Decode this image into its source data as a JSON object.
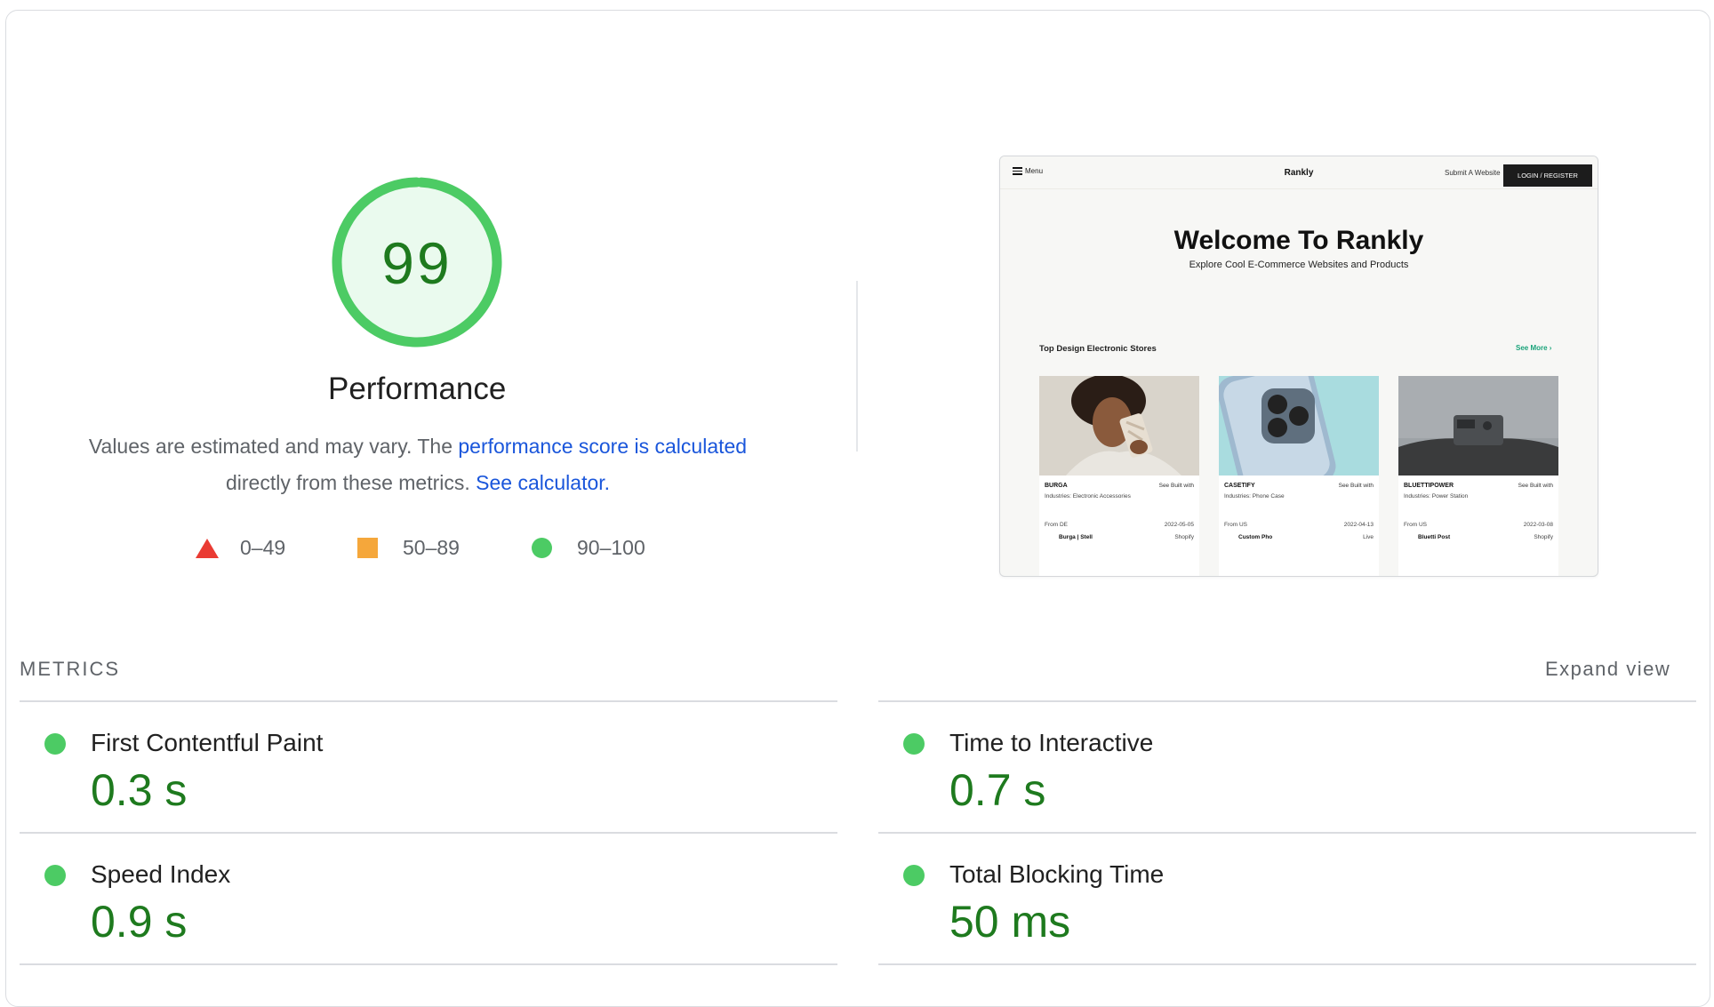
{
  "performance": {
    "score": "99",
    "category_title": "Performance",
    "description_prefix": "Values are estimated and may vary. The",
    "description_link": "performance score is calculated",
    "description_mid": "directly from these metrics.",
    "calculator_link": "See calculator.",
    "gauge_fill_fraction": 0.99,
    "colors": {
      "pass": "#0cce6b",
      "average": "#ffa400",
      "fail": "#ff4e42",
      "score_text": "#1e7a1e",
      "link": "#1a56db"
    }
  },
  "legend": [
    {
      "icon": "triangle-fail-icon",
      "label": "0–49"
    },
    {
      "icon": "square-average-icon",
      "label": "50–89"
    },
    {
      "icon": "circle-pass-icon",
      "label": "90–100"
    }
  ],
  "screenshot": {
    "nav_menu": "Menu",
    "nav_logo": "Rankly",
    "nav_submit": "Submit A Website",
    "nav_login": "LOGIN / REGISTER",
    "headline": "Welcome To Rankly",
    "subheadline": "Explore Cool E-Commerce Websites and Products",
    "section_title": "Top Design Electronic Stores",
    "see_more": "See More",
    "cards": [
      {
        "name": "BURGA",
        "built_with": "See Built with",
        "industry": "Industries:  Electronic Accessories",
        "from": "From DE",
        "date": "2022-05-05",
        "owner": "Burga | Stell",
        "platform": "Shopify"
      },
      {
        "name": "CASETIFY",
        "built_with": "See Built with",
        "industry": "Industries:  Phone Case",
        "from": "From US",
        "date": "2022-04-13",
        "owner": "Custom Pho",
        "platform": "Live"
      },
      {
        "name": "BLUETTIPOWER",
        "built_with": "See Built with",
        "industry": "Industries:  Power Station",
        "from": "From US",
        "date": "2022-03-08",
        "owner": "Bluetti Post",
        "platform": "Shopify"
      }
    ]
  },
  "metrics": {
    "section_label": "METRICS",
    "expand_label": "Expand view",
    "items": [
      {
        "title": "First Contentful Paint",
        "value": "0.3 s",
        "status": "pass"
      },
      {
        "title": "Time to Interactive",
        "value": "0.7 s",
        "status": "pass"
      },
      {
        "title": "Speed Index",
        "value": "0.9 s",
        "status": "pass"
      },
      {
        "title": "Total Blocking Time",
        "value": "50 ms",
        "status": "pass"
      }
    ]
  }
}
